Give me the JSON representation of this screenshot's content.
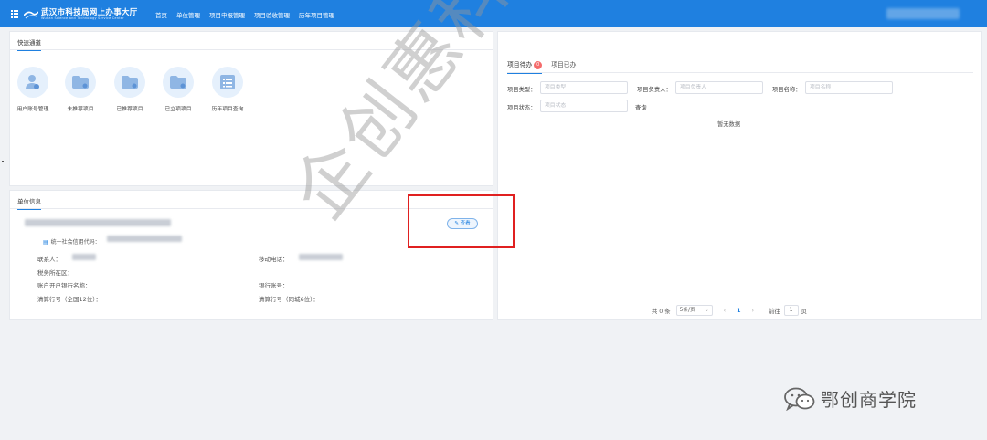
{
  "header": {
    "title": "武汉市科技局网上办事大厅",
    "subtitle": "Wuhan Science and Technology Service Center",
    "nav": [
      "首页",
      "单位管理",
      "项目申报管理",
      "项目验收管理",
      "历年项目管理"
    ]
  },
  "quick": {
    "tab": "快速通道",
    "items": [
      {
        "label": "用户账号管理",
        "icon": "user-account-icon"
      },
      {
        "label": "未推荐项目",
        "icon": "folder-icon"
      },
      {
        "label": "已推荐项目",
        "icon": "folder-icon"
      },
      {
        "label": "已立项项目",
        "icon": "folder-icon"
      },
      {
        "label": "历年项目查询",
        "icon": "list-icon"
      }
    ]
  },
  "unit": {
    "tab": "单位信息",
    "credit_label": "统一社会信用代码：",
    "edit_label": "查看",
    "contact_label": "联系人：",
    "mobile_label": "移动电话：",
    "tax_label": "税务所在区：",
    "bank_name_label": "账户开户银行名称：",
    "bank_account_label": "银行账号：",
    "clearing12_label": "清算行号（全国12位）：",
    "clearing6_label": "清算行号（同城6位）："
  },
  "project": {
    "tab_todo": "项目待办",
    "todo_count": "0",
    "tab_done": "项目已办",
    "type_label": "项目类型：",
    "type_placeholder": "项目类型",
    "owner_label": "项目负责人：",
    "owner_placeholder": "项目负责人",
    "name_label": "项目名称：",
    "name_placeholder": "项目名称",
    "status_label": "项目状态：",
    "status_placeholder": "项目状态",
    "query_label": "查询",
    "empty_text": "暂无数据"
  },
  "pager": {
    "total": "共 0 条",
    "page_size": "5条/页",
    "current_page": "1",
    "goto_label": "前往",
    "goto_value": "1",
    "page_word": "页"
  },
  "watermark": "企创惠科技咨询",
  "wechat_account": "鄂创商学院",
  "colors": {
    "primary": "#1f80e0",
    "highlight": "#e02020",
    "badge": "#f56c6c"
  }
}
